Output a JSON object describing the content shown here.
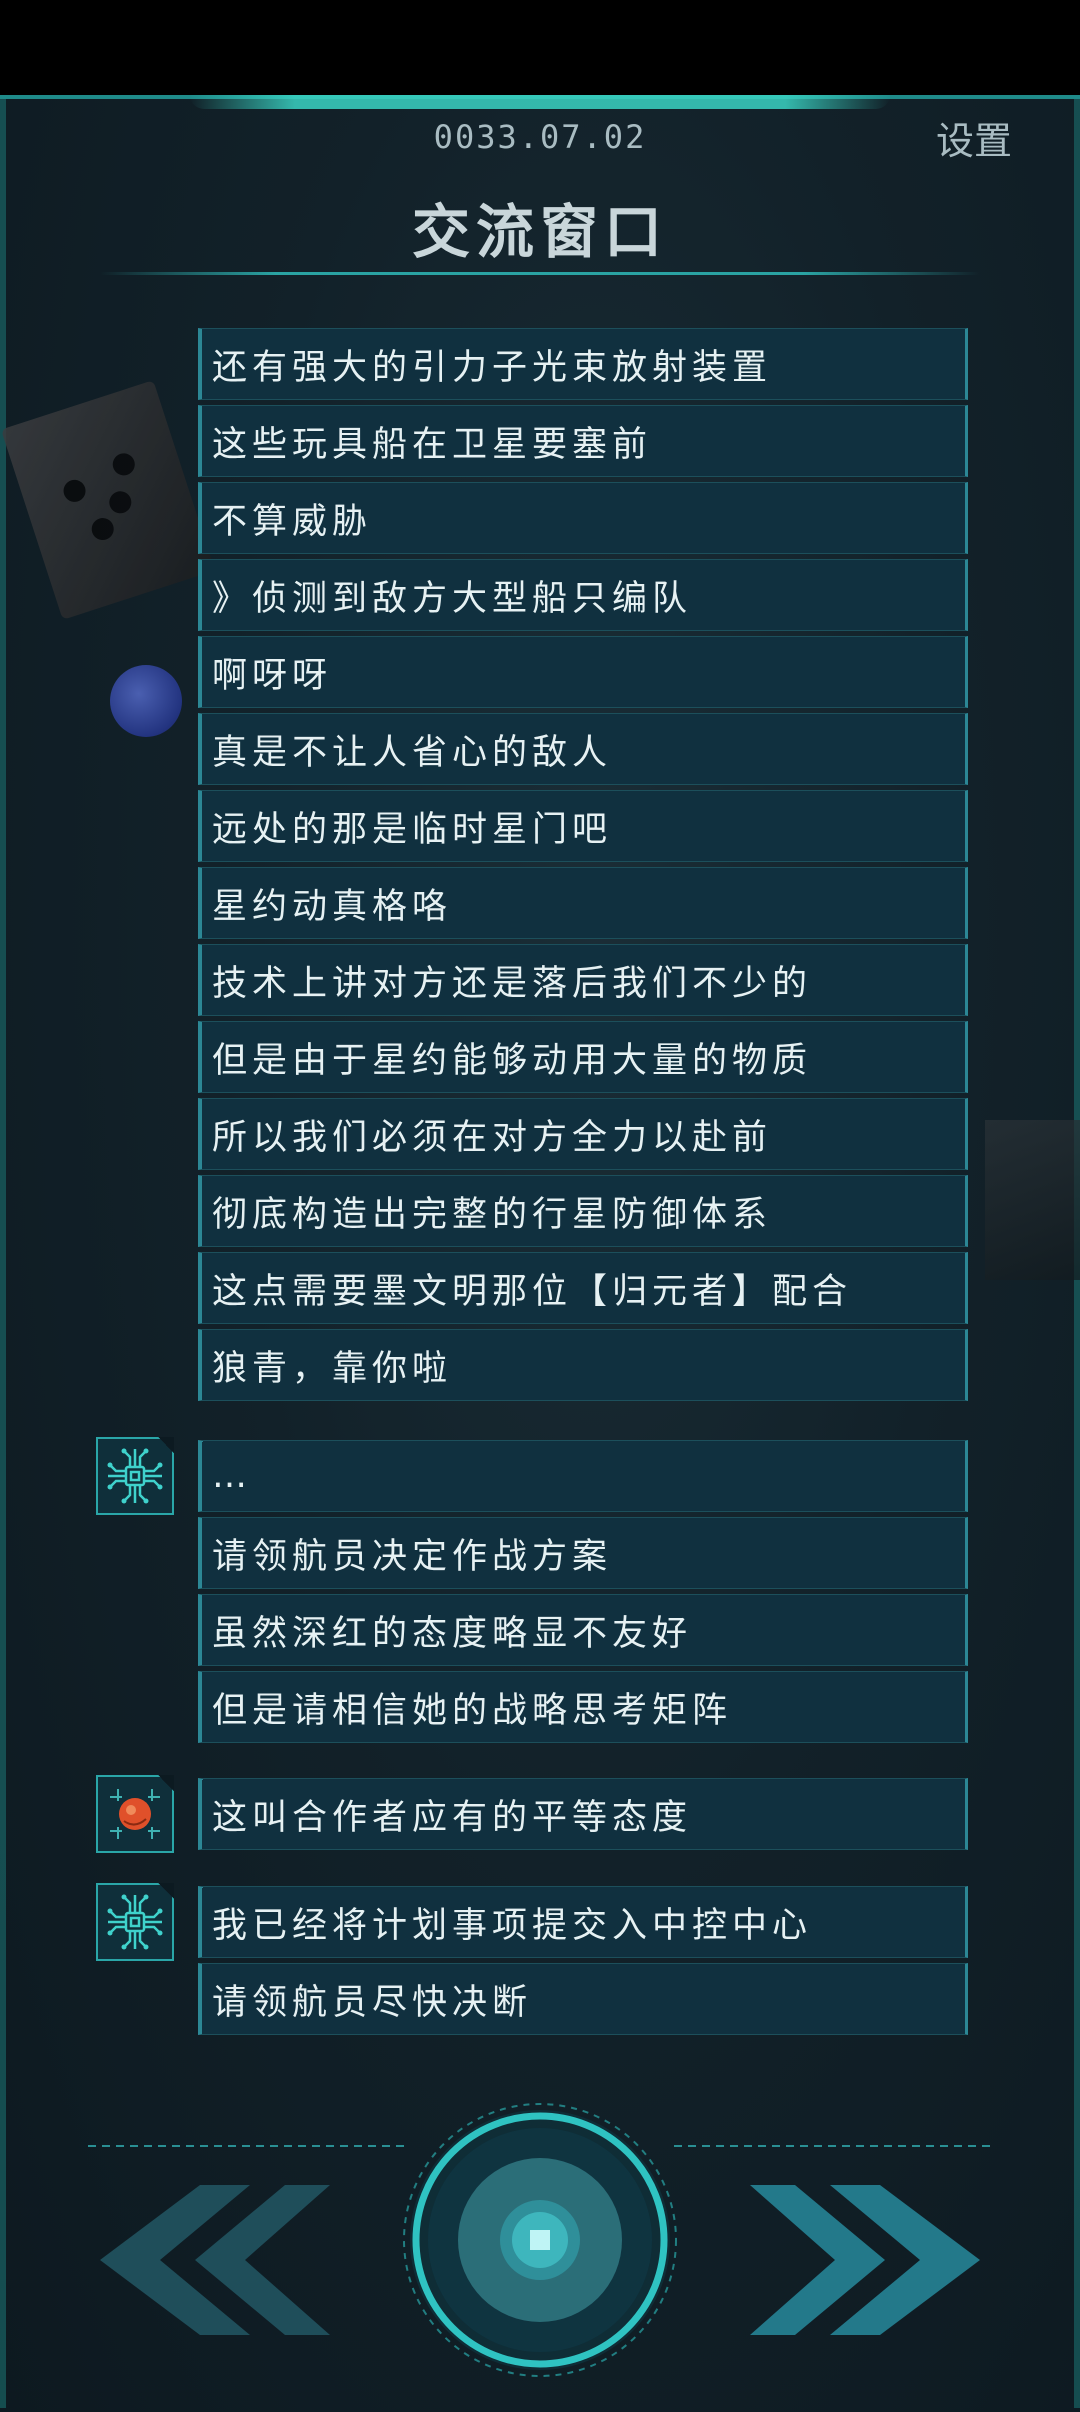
{
  "header": {
    "date": "0033.07.02",
    "settings_label": "设置",
    "title": "交流窗口"
  },
  "messages": [
    {
      "speaker": "none",
      "text": "还有强大的引力子光束放射装置"
    },
    {
      "speaker": "none",
      "text": "这些玩具船在卫星要塞前"
    },
    {
      "speaker": "none",
      "text": "不算威胁"
    },
    {
      "speaker": "none",
      "text": "》侦测到敌方大型船只编队"
    },
    {
      "speaker": "none",
      "text": "啊呀呀"
    },
    {
      "speaker": "none",
      "text": "真是不让人省心的敌人"
    },
    {
      "speaker": "none",
      "text": "远处的那是临时星门吧"
    },
    {
      "speaker": "none",
      "text": "星约动真格咯"
    },
    {
      "speaker": "none",
      "text": "技术上讲对方还是落后我们不少的"
    },
    {
      "speaker": "none",
      "text": "但是由于星约能够动用大量的物质"
    },
    {
      "speaker": "none",
      "text": "所以我们必须在对方全力以赴前"
    },
    {
      "speaker": "none",
      "text": "彻底构造出完整的行星防御体系"
    },
    {
      "speaker": "none",
      "text": "这点需要墨文明那位【归元者】配合"
    },
    {
      "speaker": "none",
      "text": "狼青，靠你啦"
    },
    {
      "speaker": "ai-core",
      "text": "…"
    },
    {
      "speaker": "ai-core",
      "text": "请领航员决定作战方案"
    },
    {
      "speaker": "ai-core",
      "text": "虽然深红的态度略显不友好"
    },
    {
      "speaker": "ai-core",
      "text": "但是请相信她的战略思考矩阵"
    },
    {
      "speaker": "red-core",
      "text": "这叫合作者应有的平等态度"
    },
    {
      "speaker": "ai-core",
      "text": "我已经将计划事项提交入中控中心"
    },
    {
      "speaker": "ai-core",
      "text": "请领航员尽快决断"
    }
  ],
  "avatars": {
    "ai-core": {
      "icon": "circuit-chip-icon",
      "color": "#3fd2cc"
    },
    "red-core": {
      "icon": "red-circuit-orb-icon",
      "color": "#e0502a"
    }
  },
  "colors": {
    "accent": "#2aa6a8",
    "bubble_bg": "#10303f",
    "text": "#e6f1f3",
    "muted": "#a9bcc2"
  },
  "controls": {
    "prev_icon": "double-chevron-left-icon",
    "next_icon": "double-chevron-right-icon",
    "center_icon": "record-button-icon"
  }
}
